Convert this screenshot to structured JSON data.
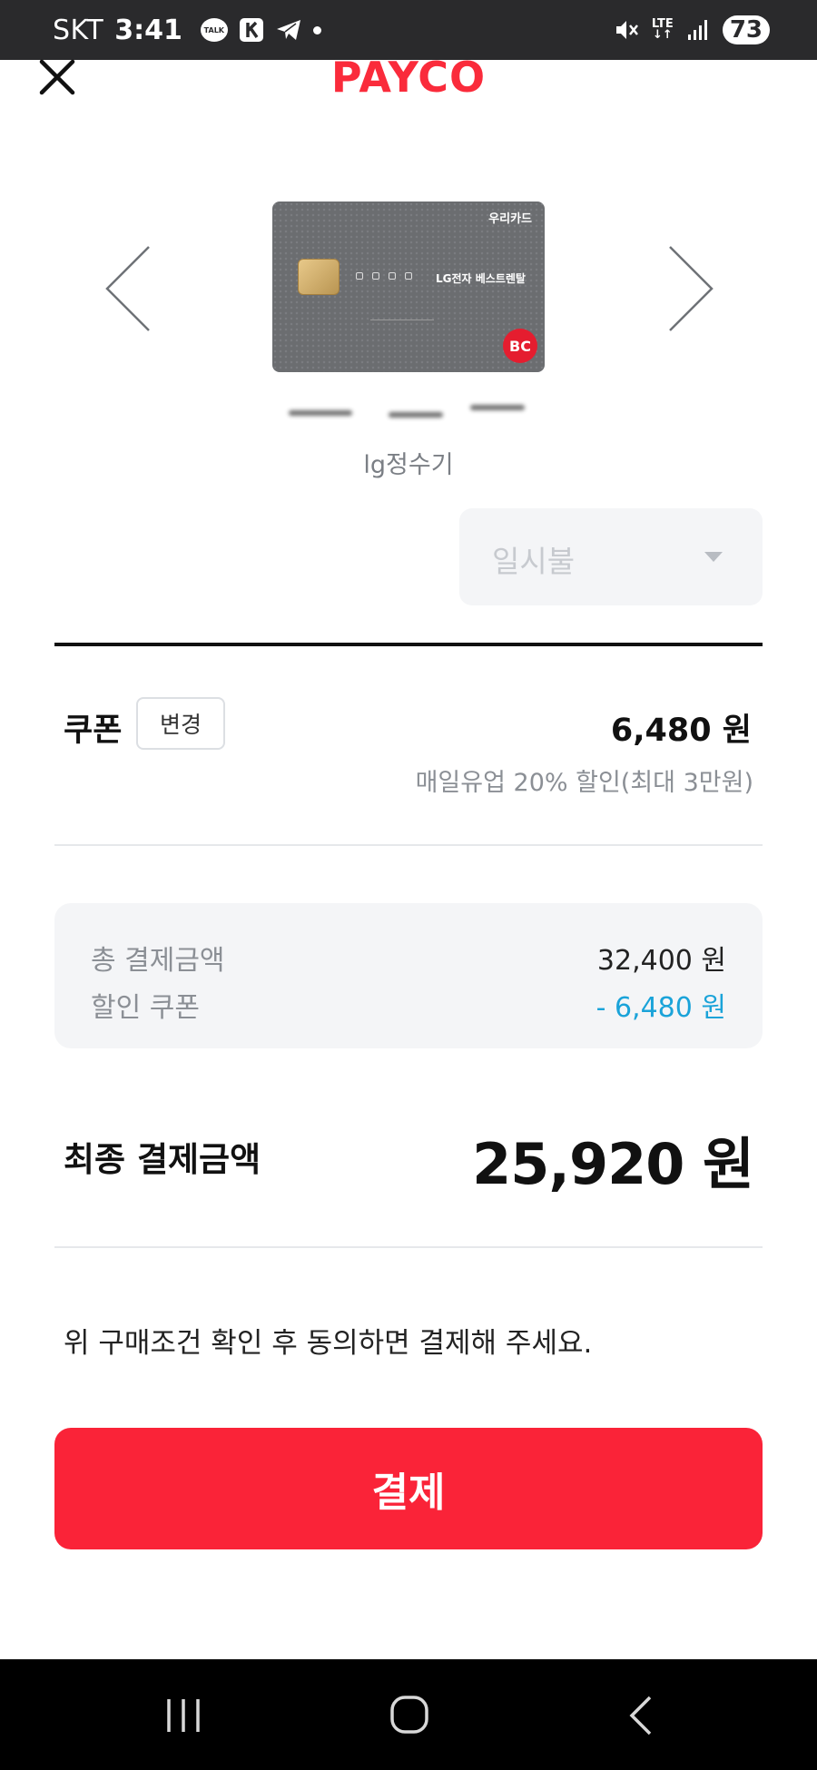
{
  "status_bar": {
    "carrier": "SKT",
    "time": "3:41",
    "talk_label": "TALK",
    "network": "LTE",
    "battery": "73",
    "icons": [
      "kakaotalk-icon",
      "app-k-icon",
      "telegram-icon",
      "notification-dot-icon",
      "mute-icon",
      "lte-icon",
      "signal-icon",
      "battery-icon"
    ]
  },
  "header": {
    "brand": "PAYCO",
    "close_icon": "close-icon",
    "brand_color": "#fa2b3b"
  },
  "card_carousel": {
    "card_bank": "우리카드",
    "card_title": "LG전자 베스트렌탈",
    "card_network": "BC",
    "card_nickname": "lg정수기",
    "prev_icon": "chevron-left-icon",
    "next_icon": "chevron-right-icon"
  },
  "installment": {
    "selected": "일시불",
    "caret_icon": "caret-down-icon"
  },
  "coupon": {
    "label": "쿠폰",
    "change_button": "변경",
    "amount": "6,480 원",
    "description": "매일유업 20% 할인(최대 3만원)"
  },
  "summary": {
    "total_label": "총 결제금액",
    "total_value": "32,400 원",
    "discount_label": "할인 쿠폰",
    "discount_value": "- 6,480 원",
    "discount_color": "#1aa3d9"
  },
  "final": {
    "label": "최종 결제금액",
    "amount": "25,920 원"
  },
  "notice": "위 구매조건 확인 후 동의하면 결제해 주세요.",
  "pay_button": {
    "label": "결제",
    "color": "#fa2338"
  },
  "nav_bar": {
    "icons": [
      "recent-apps-icon",
      "home-icon",
      "back-icon"
    ]
  }
}
